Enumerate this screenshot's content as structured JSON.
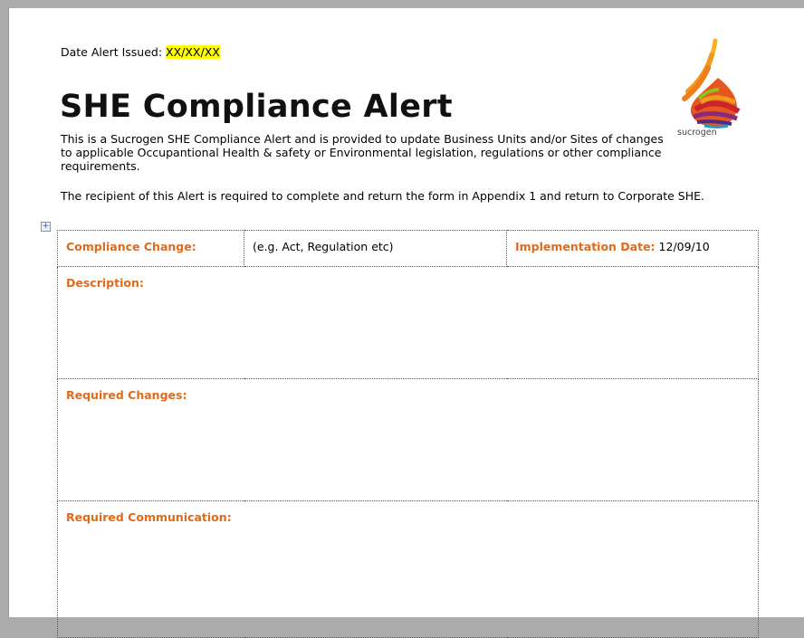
{
  "date_alert": {
    "label": "Date Alert Issued: ",
    "value": "XX/XX/XX"
  },
  "title": "SHE Compliance Alert",
  "intro": "This is a Sucrogen SHE Compliance Alert and is provided to update Business Units and/or Sites of changes to applicable Occupantional Health & safety or Environmental legislation, regulations or other compliance requirements.",
  "intro2": "The recipient of this Alert is required to complete and return the form in Appendix 1 and return to Corporate SHE.",
  "logo": {
    "text": "sucrogen",
    "icon": "sucrogen-flame-logo"
  },
  "table": {
    "compliance_change_label": "Compliance Change:",
    "compliance_change_value": "(e.g. Act, Regulation etc)",
    "implementation_date_label": "Implementation Date:",
    "implementation_date_value": " 12/09/10",
    "description_label": "Description:",
    "required_changes_label": "Required Changes:",
    "required_communication_label": "Required Communication:"
  },
  "colors": {
    "label_orange": "#e06a1c",
    "highlight": "#ffff00"
  }
}
